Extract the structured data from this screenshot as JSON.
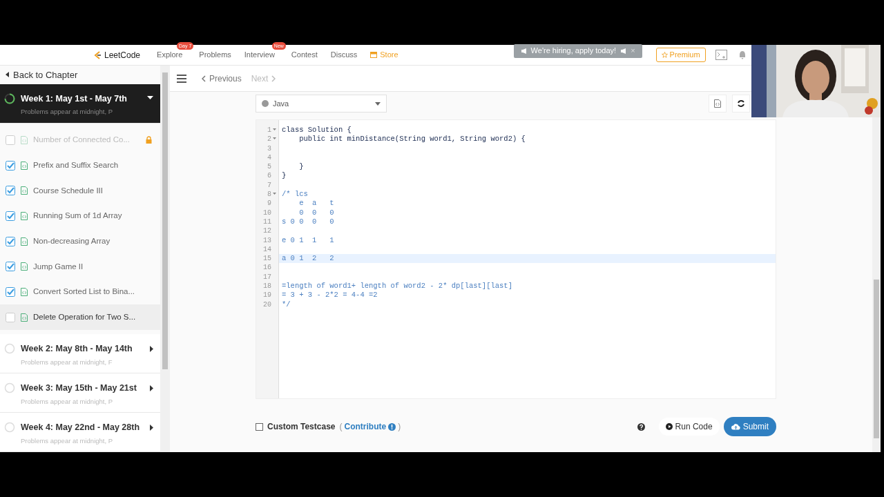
{
  "nav": {
    "logo": "LeetCode",
    "items": [
      {
        "label": "Explore",
        "badge": "Day 7",
        "kind": "link"
      },
      {
        "label": "Problems",
        "kind": "link"
      },
      {
        "label": "Interview",
        "badge": "New",
        "kind": "link"
      },
      {
        "label": "Contest",
        "kind": "link"
      },
      {
        "label": "Discuss",
        "kind": "link"
      },
      {
        "label": "Store",
        "kind": "store"
      }
    ],
    "banner": "We're hiring, apply today!",
    "banner_close": "×",
    "premium": "Premium"
  },
  "sidebar": {
    "back": "Back to Chapter",
    "weeks": [
      {
        "title": "Week 1: May 1st - May 7th",
        "subtitle": "Problems appear at midnight, P",
        "expanded": true,
        "problems": [
          {
            "title": "Number of Connected Co...",
            "checked": false,
            "locked": true,
            "selected": false
          },
          {
            "title": "Prefix and Suffix Search",
            "checked": true,
            "locked": false,
            "selected": false
          },
          {
            "title": "Course Schedule III",
            "checked": true,
            "locked": false,
            "selected": false
          },
          {
            "title": "Running Sum of 1d Array",
            "checked": true,
            "locked": false,
            "selected": false
          },
          {
            "title": "Non-decreasing Array",
            "checked": true,
            "locked": false,
            "selected": false
          },
          {
            "title": "Jump Game II",
            "checked": true,
            "locked": false,
            "selected": false
          },
          {
            "title": "Convert Sorted List to Bina...",
            "checked": true,
            "locked": false,
            "selected": false
          },
          {
            "title": "Delete Operation for Two S...",
            "checked": false,
            "locked": false,
            "selected": true
          }
        ]
      },
      {
        "title": "Week 2: May 8th - May 14th",
        "subtitle": "Problems appear at midnight, F",
        "expanded": false
      },
      {
        "title": "Week 3: May 15th - May 21st",
        "subtitle": "Problems appear at midnight, P",
        "expanded": false
      },
      {
        "title": "Week 4: May 22nd - May 28th",
        "subtitle": "Problems appear at midnight, P",
        "expanded": false
      }
    ]
  },
  "toolbar": {
    "previous": "Previous",
    "next": "Next",
    "next_disabled": true
  },
  "language": "Java",
  "code": [
    {
      "number": "1",
      "text": "class Solution {",
      "kind": "code",
      "foldable": true,
      "active": false
    },
    {
      "number": "2",
      "text": "    public int minDistance(String word1, String word2) {",
      "kind": "code",
      "foldable": true,
      "active": false
    },
    {
      "number": "3",
      "foldable": false,
      "active": false
    },
    {
      "number": "4",
      "foldable": false,
      "active": false
    },
    {
      "number": "5",
      "text": "    }",
      "kind": "code",
      "foldable": false,
      "active": false
    },
    {
      "number": "6",
      "text": "}",
      "kind": "code",
      "foldable": false,
      "active": false
    },
    {
      "number": "7",
      "foldable": false,
      "active": false
    },
    {
      "number": "8",
      "text": "/* lcs",
      "kind": "comment",
      "foldable": true,
      "active": false
    },
    {
      "number": "9",
      "text": "    e  a   t",
      "kind": "comment",
      "foldable": false,
      "active": false
    },
    {
      "number": "10",
      "text": "    0  0   0",
      "kind": "comment",
      "foldable": false,
      "active": false
    },
    {
      "number": "11",
      "text": "s 0 0  0   0",
      "kind": "comment",
      "foldable": false,
      "active": false
    },
    {
      "number": "12",
      "foldable": false,
      "active": false
    },
    {
      "number": "13",
      "text": "e 0 1  1   1",
      "kind": "comment",
      "foldable": false,
      "active": false
    },
    {
      "number": "14",
      "foldable": false,
      "active": false
    },
    {
      "number": "15",
      "text": "a 0 1  2   2",
      "kind": "comment",
      "foldable": false,
      "active": true
    },
    {
      "number": "16",
      "foldable": false,
      "active": false
    },
    {
      "number": "17",
      "foldable": false,
      "active": false
    },
    {
      "number": "18",
      "text": "=length of word1+ length of word2 - 2* dp[last][last]",
      "kind": "comment",
      "foldable": false,
      "active": false
    },
    {
      "number": "19",
      "text": "= 3 + 3 - 2*2 = 4-4 =2",
      "kind": "comment",
      "foldable": false,
      "active": false
    },
    {
      "number": "20",
      "text": "*/",
      "kind": "comment",
      "foldable": false,
      "active": false
    }
  ],
  "footer": {
    "custom_testcase": "Custom Testcase",
    "custom_checked": false,
    "open_paren": "(",
    "contribute": "Contribute",
    "close_paren": ")",
    "run": "Run Code",
    "submit": "Submit"
  }
}
